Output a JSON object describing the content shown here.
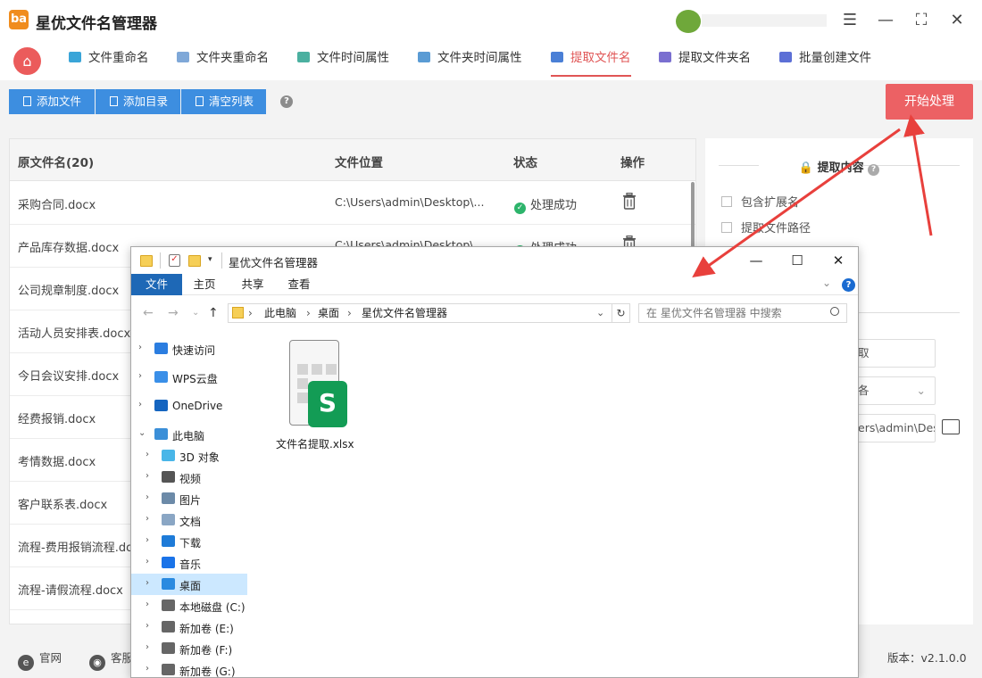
{
  "app": {
    "logo_text": "ba",
    "title": "星优文件名管理器",
    "window_controls": [
      "settings-icon",
      "minimize-icon",
      "maximize-icon",
      "close-icon"
    ]
  },
  "nav": {
    "home_icon": "home-icon",
    "tabs": [
      {
        "label": "文件重命名",
        "icon_color": "#3aa5d8"
      },
      {
        "label": "文件夹重命名",
        "icon_color": "#7fa8d8"
      },
      {
        "label": "文件时间属性",
        "icon_color": "#4bb0a0"
      },
      {
        "label": "文件夹时间属性",
        "icon_color": "#5a9bd4"
      },
      {
        "label": "提取文件名",
        "icon_color": "#4a7fd6"
      },
      {
        "label": "提取文件夹名",
        "icon_color": "#7a6fd0"
      },
      {
        "label": "批量创建文件",
        "icon_color": "#5c6fd6"
      }
    ],
    "active_tab": 4
  },
  "toolbar": {
    "add_file": "添加文件",
    "add_dir": "添加目录",
    "clear_list": "清空列表",
    "help": "?",
    "start": "开始处理",
    "accent": "#3d8ee0",
    "start_color": "#ec6164"
  },
  "file_table": {
    "headers": {
      "name": "原文件名(20)",
      "path": "文件位置",
      "status": "状态",
      "action": "操作"
    },
    "rows": [
      {
        "name": "采购合同.docx",
        "path": "C:\\Users\\admin\\Desktop\\...",
        "status": "处理成功"
      },
      {
        "name": "产品库存数据.docx",
        "path": "C:\\Users\\admin\\Desktop\\...",
        "status": "处理成功"
      },
      {
        "name": "公司规章制度.docx",
        "path": "",
        "status": ""
      },
      {
        "name": "活动人员安排表.docx",
        "path": "",
        "status": ""
      },
      {
        "name": "今日会议安排.docx",
        "path": "",
        "status": ""
      },
      {
        "name": "经费报销.docx",
        "path": "",
        "status": ""
      },
      {
        "name": "考情数据.docx",
        "path": "",
        "status": ""
      },
      {
        "name": "客户联系表.docx",
        "path": "",
        "status": ""
      },
      {
        "name": "流程-费用报销流程.docx",
        "path": "",
        "status": ""
      },
      {
        "name": "流程-请假流程.docx",
        "path": "",
        "status": ""
      }
    ]
  },
  "side_panel": {
    "title": "提取内容",
    "options": [
      "包含扩展名",
      "提取文件路径"
    ],
    "fields": [
      "取",
      "各",
      "ers\\admin\\Des"
    ]
  },
  "footer": {
    "website": "官网",
    "service": "客服",
    "version": "版本：v2.1.0.0"
  },
  "explorer": {
    "title": "星优文件名管理器",
    "ribbon_tabs": [
      "文件",
      "主页",
      "共享",
      "查看"
    ],
    "address": [
      "此电脑",
      "桌面",
      "星优文件名管理器"
    ],
    "search_placeholder": "在 星优文件名管理器 中搜索",
    "nav_items": [
      {
        "label": "快速访问",
        "icon_color": "#2b7de0",
        "level": 0
      },
      {
        "label": "WPS云盘",
        "icon_color": "#3a8fe8",
        "level": 0
      },
      {
        "label": "OneDrive",
        "icon_color": "#1565c0",
        "level": 0
      },
      {
        "label": "此电脑",
        "icon_color": "#3b8fd8",
        "level": 0
      },
      {
        "label": "3D 对象",
        "icon_color": "#49b6e8",
        "level": 1
      },
      {
        "label": "视频",
        "icon_color": "#555555",
        "level": 1
      },
      {
        "label": "图片",
        "icon_color": "#6c8aa8",
        "level": 1
      },
      {
        "label": "文档",
        "icon_color": "#8aa6c4",
        "level": 1
      },
      {
        "label": "下载",
        "icon_color": "#1e7bd8",
        "level": 1
      },
      {
        "label": "音乐",
        "icon_color": "#1a73e8",
        "level": 1
      },
      {
        "label": "桌面",
        "icon_color": "#2a8ae0",
        "level": 1
      },
      {
        "label": "本地磁盘 (C:)",
        "icon_color": "#666666",
        "level": 1
      },
      {
        "label": "新加卷 (E:)",
        "icon_color": "#666666",
        "level": 1
      },
      {
        "label": "新加卷 (F:)",
        "icon_color": "#666666",
        "level": 1
      },
      {
        "label": "新加卷 (G:)",
        "icon_color": "#666666",
        "level": 1
      }
    ],
    "selected_nav": 10,
    "file": {
      "name": "文件名提取.xlsx",
      "badge": "S"
    }
  }
}
